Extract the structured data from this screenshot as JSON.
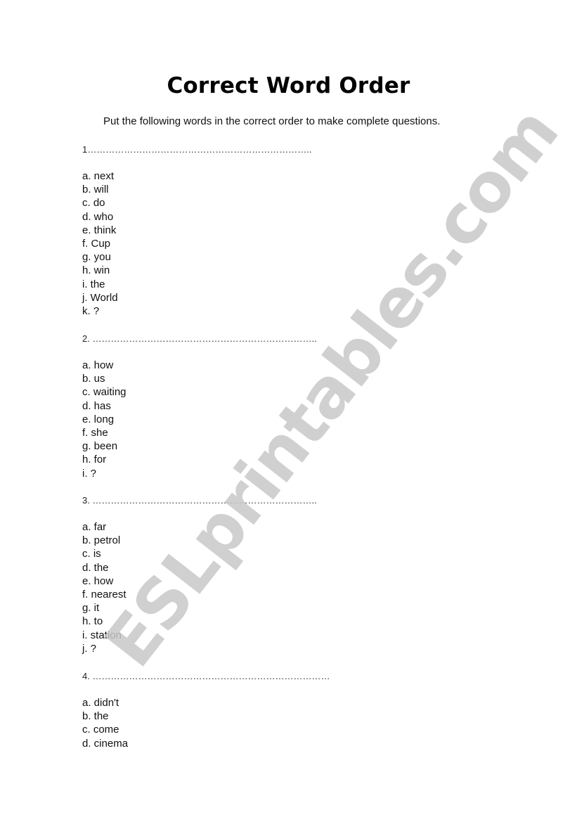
{
  "document": {
    "title": "Correct Word Order",
    "instructions": "Put the following words in the correct order to make complete questions.",
    "watermark": "ESLprintables.com",
    "questions": [
      {
        "number": "1",
        "answer_line": "1………………………………………………………………..",
        "items": [
          "a. next",
          "b. will",
          "c. do",
          "d. who",
          "e. think",
          "f. Cup",
          "g. you",
          "h. win",
          "i. the",
          "j. World",
          "k. ?"
        ]
      },
      {
        "number": "2",
        "answer_line": "2. ………………………………………………………………..",
        "items": [
          "a. how",
          "b. us",
          "c. waiting",
          "d. has",
          "e. long",
          "f. she",
          "g. been",
          "h. for",
          "i. ?"
        ]
      },
      {
        "number": "3",
        "answer_line": "3. ………………………………………………………………..",
        "items": [
          "a. far",
          "b. petrol",
          "c. is",
          "d. the",
          "e. how",
          "f. nearest",
          "g. it",
          "h. to",
          "i. station",
          "j. ?"
        ]
      },
      {
        "number": "4",
        "answer_line": "4. ……………………………………………………………………",
        "items": [
          "a. didn't",
          "b. the",
          "c. come",
          "d. cinema"
        ]
      }
    ]
  }
}
